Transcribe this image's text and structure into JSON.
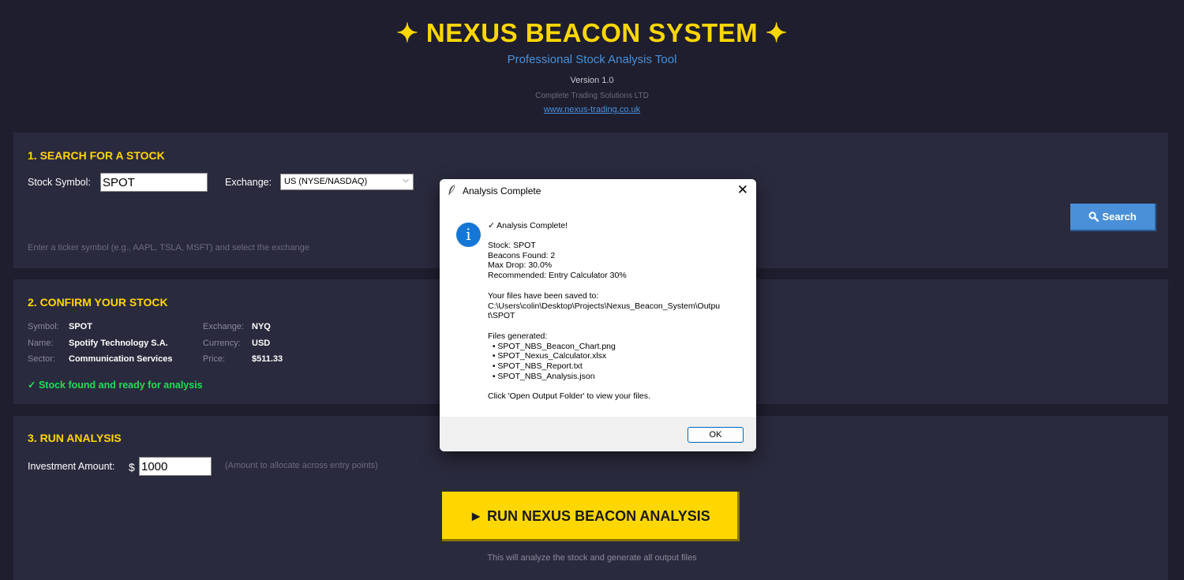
{
  "header": {
    "title": "✦ NEXUS BEACON SYSTEM ✦",
    "subtitle": "Professional Stock Analysis Tool",
    "version": "Version 1.0",
    "company": "Complete Trading Solutions LTD",
    "website": "www.nexus-trading.co.uk"
  },
  "search_section": {
    "title": "1. SEARCH FOR A STOCK",
    "symbol_label": "Stock Symbol:",
    "symbol_value": "SPOT",
    "exchange_label": "Exchange:",
    "exchange_value": "US (NYSE/NASDAQ)",
    "search_button": "Search",
    "hint": "Enter a ticker symbol (e.g., AAPL, TSLA, MSFT) and select the exchange"
  },
  "confirm_section": {
    "title": "2. CONFIRM YOUR STOCK",
    "symbol_key": "Symbol:",
    "symbol_val": "SPOT",
    "name_key": "Name:",
    "name_val": "Spotify Technology S.A.",
    "sector_key": "Sector:",
    "sector_val": "Communication Services",
    "exchange_key": "Exchange:",
    "exchange_val": "NYQ",
    "currency_key": "Currency:",
    "currency_val": "USD",
    "price_key": "Price:",
    "price_val": "$511.33",
    "status": "✓  Stock found and ready for analysis"
  },
  "run_section": {
    "title": "3. RUN ANALYSIS",
    "investment_label": "Investment Amount:",
    "currency_symbol": "$",
    "investment_value": "1000",
    "investment_hint": "(Amount to allocate across entry points)",
    "run_button": "►  RUN NEXUS BEACON ANALYSIS",
    "run_note": "This will analyze the stock and generate all output files"
  },
  "dialog": {
    "title": "Analysis Complete",
    "close": "✕",
    "heading": "✓ Analysis Complete!",
    "details": "Stock: SPOT\nBeacons Found: 2\nMax Drop: 30.0%\nRecommended: Entry Calculator 30%",
    "saved_to": "Your files have been saved to:\nC:\\Users\\colin\\Desktop\\Projects\\Nexus_Beacon_System\\Outpu\nt\\SPOT",
    "files": "Files generated:\n  • SPOT_NBS_Beacon_Chart.png\n  • SPOT_Nexus_Calculator.xlsx\n  • SPOT_NBS_Report.txt\n  • SPOT_NBS_Analysis.json",
    "footer_note": "Click 'Open Output Folder' to view your files.",
    "ok_button": "OK",
    "info_glyph": "i"
  },
  "colors": {
    "background": "#1e1e2e",
    "panel": "#2a2a3e",
    "accent_gold": "#ffd700",
    "accent_blue": "#4a90d9",
    "success_green": "#22dd55",
    "dialog_info_blue": "#1577d5"
  },
  "icons": {
    "search": "search-icon",
    "dialog_titlebar": "feather-icon",
    "dialog_info": "info-icon",
    "dialog_close": "close-icon",
    "exchange_dropdown": "chevron-down-icon"
  }
}
